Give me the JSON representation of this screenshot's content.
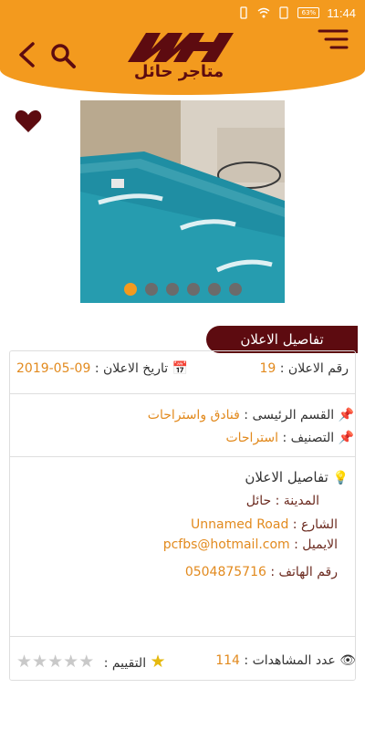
{
  "status_bar": {
    "battery": "63%",
    "time": "11:44"
  },
  "header": {
    "logo_text": "متاجر حائل"
  },
  "slider": {
    "total": 6,
    "active_index": 0
  },
  "section": {
    "title": "تفاصيل الاعلان"
  },
  "ad": {
    "number_label": "رقم الاعلان :",
    "number_value": "19",
    "date_label": "تاريخ الاعلان :",
    "date_value": "2019-05-09",
    "main_section_label": "القسم الرئيسى :",
    "main_section_value": "فنادق واستراحات",
    "classification_label": "التصنيف :",
    "classification_value": "استراحات",
    "details_title": "تفاصيل الاعلان",
    "city_label": "المدينة :",
    "city_value": "حائل",
    "street_label": "الشارع :",
    "street_value": "Unnamed Road",
    "email_label": "الايميل :",
    "email_value": "pcfbs@hotmail.com",
    "phone_label": "رقم الهاتف :",
    "phone_value": "0504875716",
    "views_label": "عدد المشاهدات :",
    "views_value": "114",
    "rating_label": "التقييم :",
    "rating_value": 0,
    "rating_max": 5
  },
  "colors": {
    "accent": "#f39a1e",
    "brand": "#5d0b10",
    "value_text": "#e28a1e"
  },
  "icons": [
    "back-arrow-icon",
    "search-icon",
    "menu-icon",
    "heart-icon",
    "calendar-icon",
    "pin-icon",
    "bulb-icon",
    "eye-icon",
    "star-icon"
  ]
}
